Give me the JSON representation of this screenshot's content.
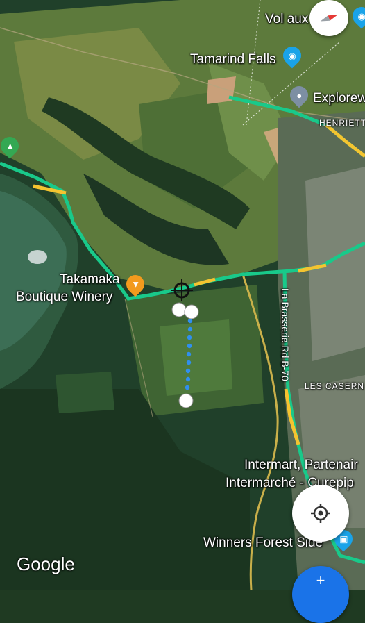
{
  "places": {
    "vol_aux": "Vol aux",
    "tamarind_falls": "Tamarind Falls",
    "explorew": "Explorew",
    "henriett": "HENRIETT",
    "takamaka_line1": "Takamaka",
    "takamaka_line2": "Boutique Winery",
    "la_brasserie": "La Brasserie Rd B-70",
    "les_casern": "LES CASERN",
    "intermart": "Intermart, Partenair",
    "intermarche": "Intermarché - Curepip",
    "winners": "Winners Forest Side"
  },
  "attribution": "Google",
  "colors": {
    "route_green": "#19c98a",
    "route_yellow": "#f4c430",
    "road_yellow": "#c9b04a",
    "poi_blue": "#1aa3e8",
    "poi_orange": "#f29a1d",
    "poi_grey": "#7d8fa3",
    "park_green": "#34a853",
    "dot_blue": "#2f8ff0",
    "fab_blue": "#1a73e8"
  },
  "icons": [
    "compass-icon",
    "camera-icon",
    "location-pin-icon",
    "tree-icon",
    "wine-glass-icon",
    "shopping-cart-icon",
    "my-location-icon",
    "directions-icon"
  ]
}
